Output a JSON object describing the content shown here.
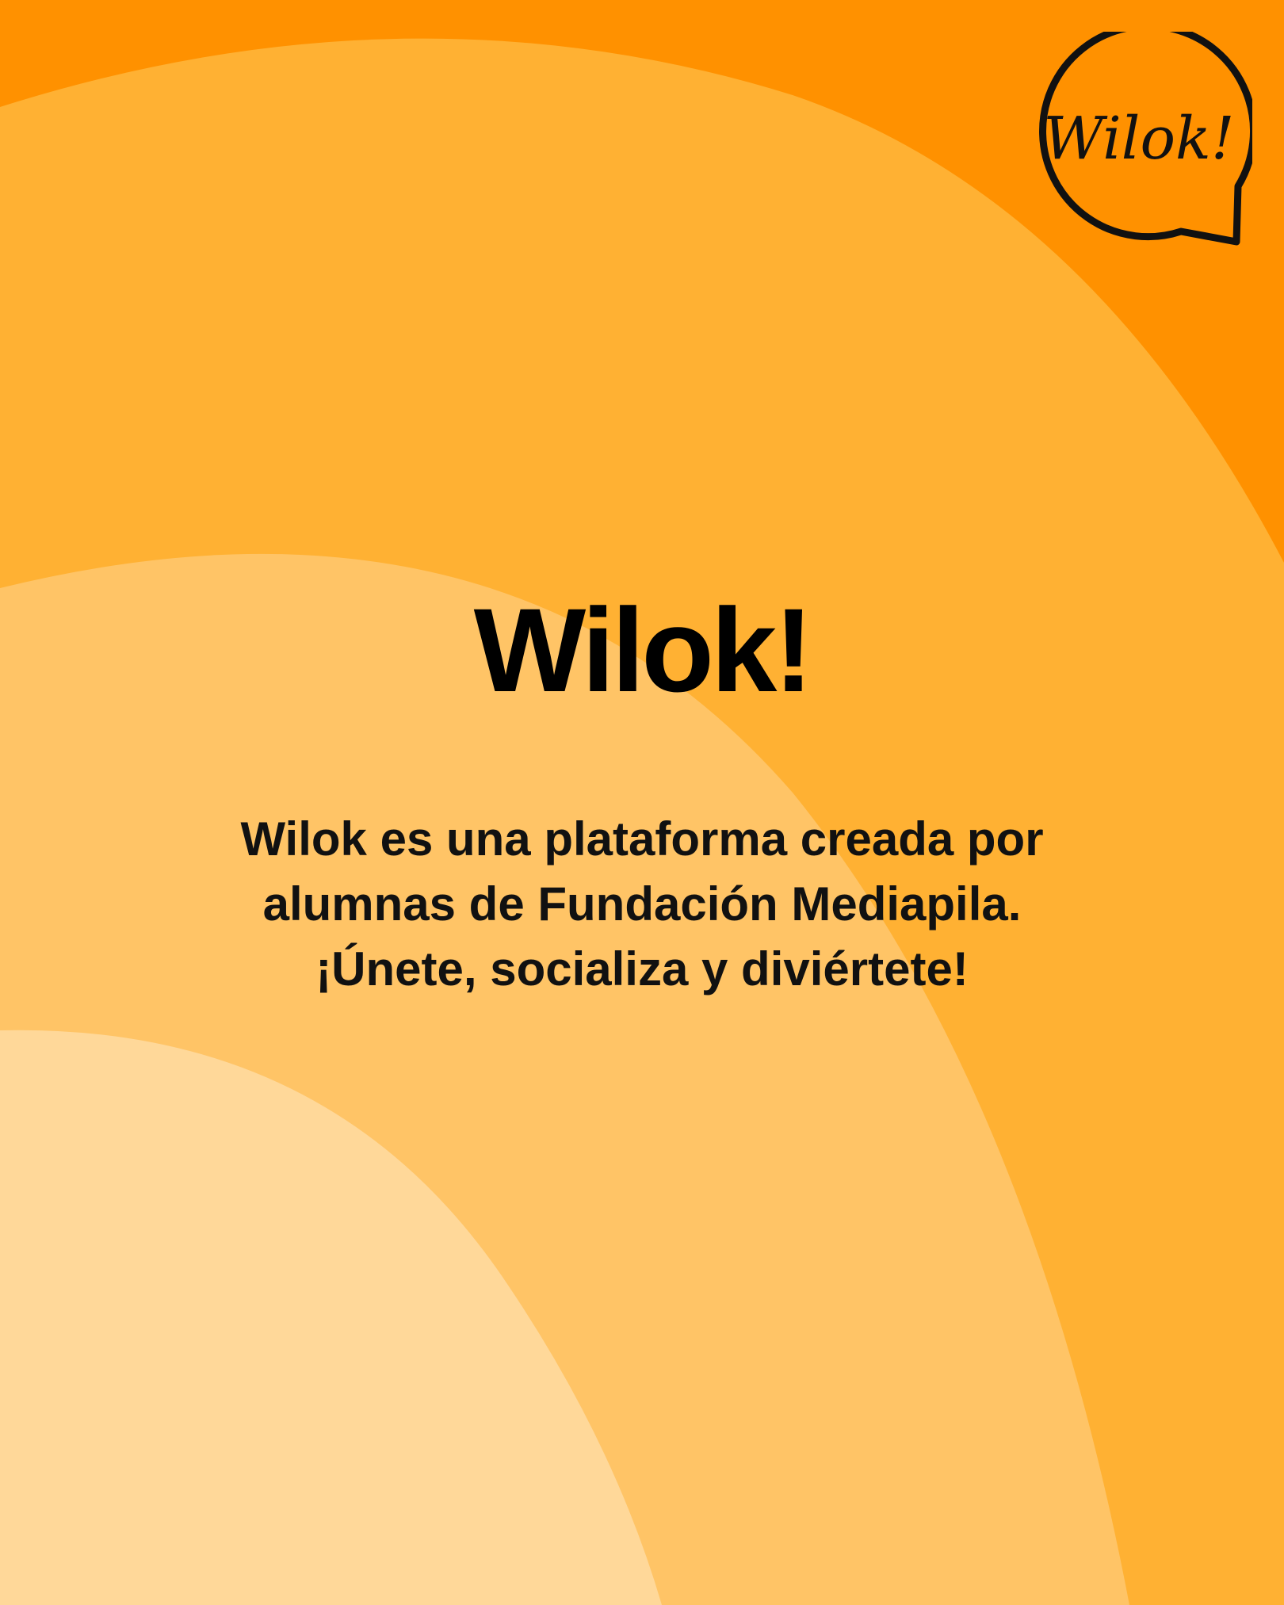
{
  "colors": {
    "background": "#ff9100",
    "band_1": "#ffb133",
    "band_2": "#ffc466",
    "band_3": "#ffd899",
    "text": "#000000"
  },
  "logo": {
    "text": "Wilok!",
    "icon": "speech-bubble-icon"
  },
  "title": "Wilok!",
  "description": {
    "line1": "Wilok es una plataforma creada por",
    "line2": "alumnas de Fundación Mediapila.",
    "line3": "¡Únete, socializa y diviértete!"
  }
}
